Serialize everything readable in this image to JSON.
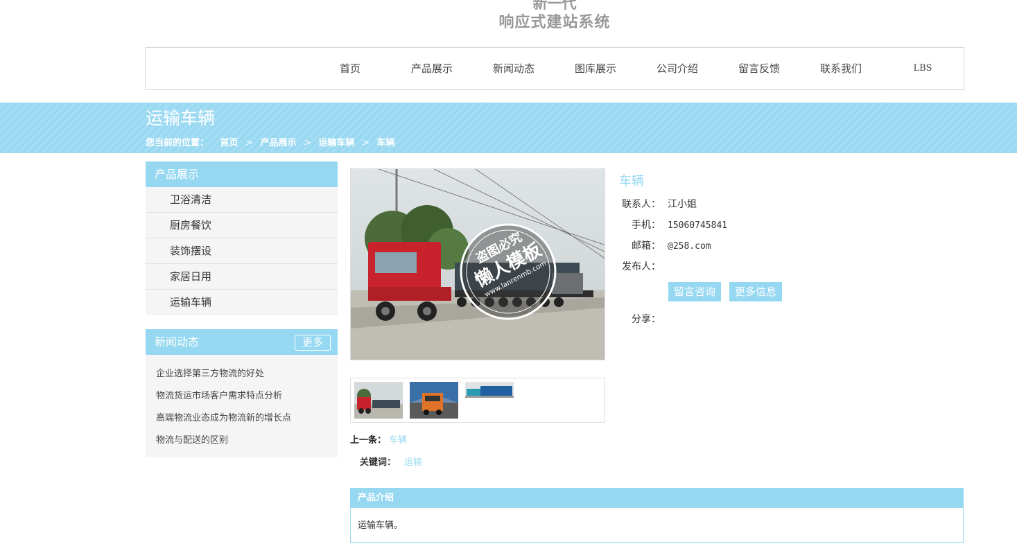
{
  "logo": {
    "line1": "新一代",
    "line2": "响应式建站系统"
  },
  "nav": [
    "首页",
    "产品展示",
    "新闻动态",
    "图库展示",
    "公司介绍",
    "留言反馈",
    "联系我们",
    "LBS"
  ],
  "banner": {
    "title": "运输车辆",
    "crumb_label": "您当前的位置：",
    "crumbs": [
      "首页",
      "产品展示",
      "运输车辆",
      "车辆"
    ],
    "sep": ">"
  },
  "sidebar": {
    "categories_title": "产品展示",
    "categories": [
      "卫浴清洁",
      "厨房餐饮",
      "装饰摆设",
      "家居日用",
      "运输车辆"
    ],
    "news_title": "新闻动态",
    "news_more": "更多",
    "news": [
      "企业选择第三方物流的好处",
      "物流货运市场客户需求特点分析",
      "高端物流业态成为物流新的增长点",
      "物流与配送的区别"
    ]
  },
  "watermark": {
    "line1": "盗图必究",
    "line2": "懒人模板",
    "url": "www.lanrenmb.com"
  },
  "product": {
    "title": "车辆",
    "contact_label": "联系人：",
    "contact": "江小姐",
    "phone_label": "手机：",
    "phone": "15060745841",
    "email_label": "邮箱：",
    "email": "@258.com",
    "publisher_label": "发布人：",
    "publisher": "",
    "consult_btn": "留言咨询",
    "more_btn": "更多信息",
    "share_label": "分享："
  },
  "prev": {
    "label": "上一条：",
    "link": "车辆"
  },
  "keywords": {
    "label": "关键词：",
    "value": "运输"
  },
  "description": {
    "title": "产品介绍",
    "text": "运输车辆。"
  },
  "colors": {
    "accent": "#96d8f2",
    "nav_border": "#d6d6d6",
    "sidebar_bg": "#f5f5f5"
  }
}
